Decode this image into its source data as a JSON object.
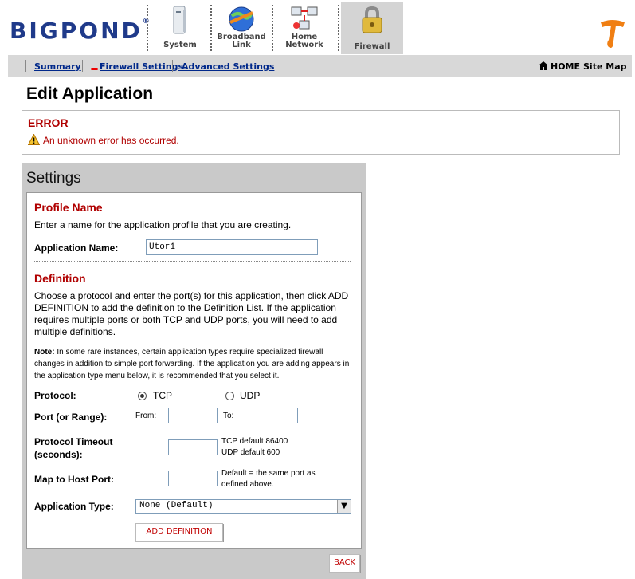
{
  "brand": {
    "logo_text": "BIGPOND",
    "logo_reg": "®"
  },
  "nav_tabs": [
    {
      "label_line1": "System",
      "label_line2": ""
    },
    {
      "label_line1": "Broadband",
      "label_line2": "Link"
    },
    {
      "label_line1": "Home",
      "label_line2": "Network"
    },
    {
      "label_line1": "Firewall",
      "label_line2": ""
    }
  ],
  "subnav": {
    "summary": "Summary",
    "firewall_settings": "Firewall Settings",
    "advanced_settings": "Advanced Settings",
    "home": "HOME",
    "site_map": "Site Map"
  },
  "page_title": "Edit Application",
  "error": {
    "title": "ERROR",
    "message": "An unknown error has occurred."
  },
  "settings": {
    "title": "Settings",
    "profile": {
      "heading": "Profile Name",
      "description": "Enter a name for the application profile that you are creating.",
      "app_name_label": "Application Name:",
      "app_name_value": "Utor1"
    },
    "definition": {
      "heading": "Definition",
      "description": "Choose a protocol and enter the port(s) for this application, then click ADD DEFINITION to add the definition to the Definition List. If the application requires multiple ports or both TCP and UDP ports, you will need to add multiple definitions.",
      "note_label": "Note:",
      "note_text": " In some rare instances, certain application types require specialized firewall changes in addition to simple port forwarding. If the application you are adding appears in the application type menu below, it is recommended that you select it.",
      "protocol_label": "Protocol:",
      "tcp_label": "TCP",
      "udp_label": "UDP",
      "protocol_selected": "TCP",
      "port_label": "Port (or Range):",
      "from_label": "From:",
      "to_label": "To:",
      "from_value": "",
      "to_value": "",
      "timeout_label_1": "Protocol Timeout",
      "timeout_label_2": "(seconds):",
      "timeout_value": "",
      "timeout_hint_1": "TCP default 86400",
      "timeout_hint_2": "UDP default 600",
      "map_label": "Map to Host Port:",
      "map_value": "",
      "map_hint_1": "Default = the same port as",
      "map_hint_2": "defined above.",
      "apptype_label": "Application Type:",
      "apptype_value": "None (Default)",
      "add_button": "ADD DEFINITION"
    },
    "back_button": "BACK"
  }
}
